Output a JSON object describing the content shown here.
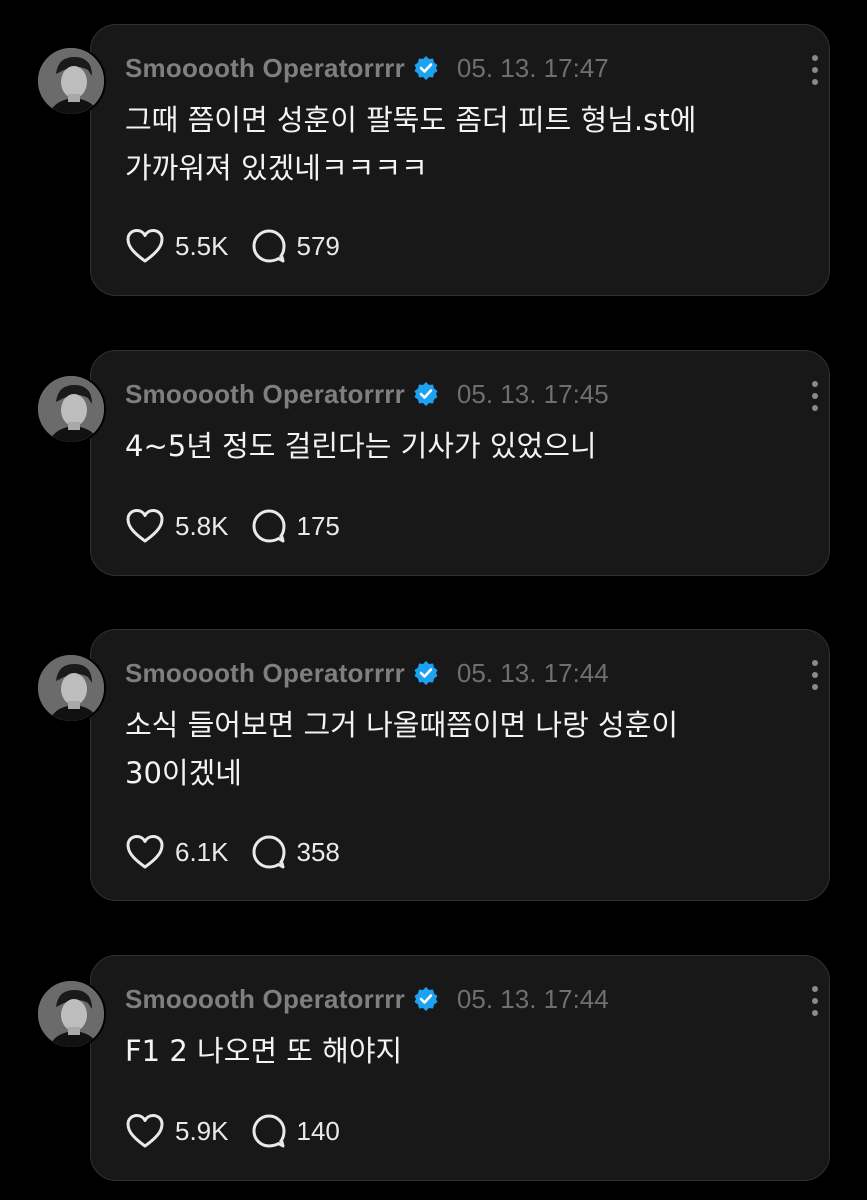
{
  "posts": [
    {
      "author": "Smooooth Operatorrrr",
      "verified": true,
      "timestamp": "05. 13. 17:47",
      "text_lines": [
        "그때 쯤이면 성훈이 팔뚝도 좀더 피트 형님.st에",
        "가까워져 있겠네ㅋㅋㅋㅋ"
      ],
      "likes": "5.5K",
      "replies": "579"
    },
    {
      "author": "Smooooth Operatorrrr",
      "verified": true,
      "timestamp": "05. 13. 17:45",
      "text_lines": [
        "4~5년 정도 걸린다는 기사가 있었으니"
      ],
      "likes": "5.8K",
      "replies": "175"
    },
    {
      "author": "Smooooth Operatorrrr",
      "verified": true,
      "timestamp": "05. 13. 17:44",
      "text_lines": [
        "소식 들어보면 그거 나올때쯤이면 나랑 성훈이",
        "30이겠네"
      ],
      "likes": "6.1K",
      "replies": "358"
    },
    {
      "author": "Smooooth Operatorrrr",
      "verified": true,
      "timestamp": "05. 13. 17:44",
      "text_lines": [
        "F1 2 나오면 또 해야지"
      ],
      "likes": "5.9K",
      "replies": "140"
    }
  ],
  "colors": {
    "background": "#000000",
    "card": "#181818",
    "card_border": "#303030",
    "author": "#7f7f7f",
    "timestamp": "#6f6f6f",
    "text": "#f3f3f3",
    "verified_badge": "#1da1f2"
  },
  "icons": {
    "like": "heart-icon",
    "reply": "speech-bubble-icon",
    "more": "more-vertical-icon",
    "verified": "verified-badge-icon"
  }
}
